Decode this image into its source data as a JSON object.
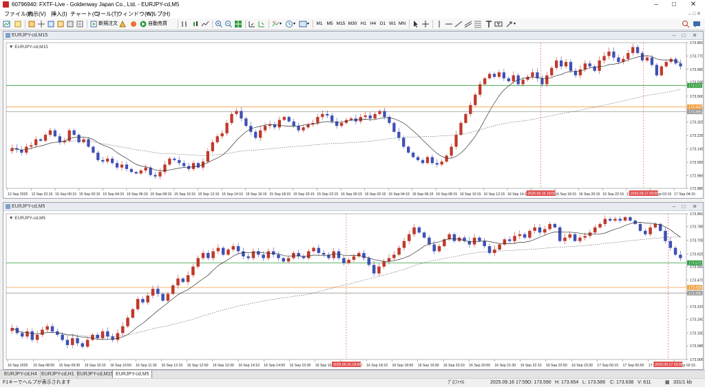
{
  "window": {
    "title": "60796940: FXTF-Live - Goldenway Japan Co., Ltd. - EURJPY-cd,M5"
  },
  "menu": [
    "ファイル(F)",
    "表示(V)",
    "挿入(I)",
    "チャート(C)",
    "ツール(T)",
    "ウィンドウ(W)",
    "ヘルプ(H)"
  ],
  "toolbar": {
    "new_order": "新規注文",
    "auto_trade": "自動売買",
    "timeframes": [
      "M1",
      "M5",
      "M15",
      "M30",
      "H1",
      "H4",
      "D1",
      "W1",
      "MN"
    ]
  },
  "colors": {
    "bull": "#c0392b",
    "bear": "#3f51b5",
    "green_line": "#2e9c3c",
    "orange_line": "#f0a040",
    "vline": "#e05050"
  },
  "charts": [
    {
      "id": "m15",
      "window_title": "EURJPY-cd,M15",
      "label": "EURJPY-cd,M15",
      "chart_data": {
        "type": "candlestick",
        "symbol": "EURJPY-cd",
        "timeframe": "M15",
        "ylim": [
          172.88,
          173.86
        ],
        "yticks": [
          173.86,
          173.77,
          173.68,
          173.595,
          173.5,
          173.415,
          173.325,
          173.235,
          173.145,
          173.055,
          172.965,
          172.88
        ],
        "ytick_labels": [
          "173.860",
          "173.770",
          "173.680",
          "173.595",
          "173.500",
          "173.415",
          "173.325",
          "173.235",
          "173.145",
          "173.055",
          "172.965",
          "172.880"
        ],
        "xtick_labels": [
          "12 Sep 2025",
          "12 Sep 22:15",
          "15 Sep 00:15",
          "15 Sep 02:15",
          "15 Sep 04:15",
          "15 Sep 06:15",
          "15 Sep 08:15",
          "15 Sep 10:15",
          "15 Sep 12:15",
          "15 Sep 14:15",
          "15 Sep 16:15",
          "15 Sep 18:15",
          "15 Sep 20:15",
          "15 Sep 22:15",
          "16 Sep 00:15",
          "16 Sep 02:15",
          "16 Sep 04:15",
          "16 Sep 06:15",
          "16 Sep 08:15",
          "16 Sep 10:15",
          "16 Sep 12:15",
          "16 Sep 14:15",
          "16 Sep 16:15",
          "16 Sep 18:15",
          "16 Sep 20:15",
          "16 Sep 22:15",
          "17 Sep 00:15",
          "17 Sep 02:15",
          "17 Sep 04:15"
        ],
        "hlines": [
          {
            "price": 173.572,
            "label": "173.572",
            "color": "#2e9c3c"
          },
          {
            "price": 173.428,
            "label": "173.428",
            "color": "#f0a040"
          },
          {
            "price": 173.395,
            "label": "173.395",
            "color": "#9a9a9a"
          }
        ],
        "vlines": [
          {
            "label": "2025.09.16 18:00",
            "index": 0.786
          },
          {
            "label": "2025.09.17 03:00",
            "index": 0.937
          }
        ],
        "close": [
          173.15,
          173.14,
          173.12,
          173.16,
          173.17,
          173.21,
          173.2,
          173.24,
          173.27,
          173.23,
          173.19,
          173.2,
          173.27,
          173.24,
          173.19,
          173.21,
          173.16,
          173.12,
          173.07,
          173.06,
          173.08,
          173.05,
          173.02,
          173.04,
          173.01,
          172.99,
          172.98,
          173.0,
          173.02,
          172.97,
          172.96,
          172.99,
          173.04,
          173.08,
          173.07,
          173.05,
          173.03,
          173.01,
          173.05,
          173.02,
          173.06,
          173.13,
          173.19,
          173.23,
          173.25,
          173.32,
          173.38,
          173.4,
          173.35,
          173.3,
          173.26,
          173.22,
          173.27,
          173.3,
          173.31,
          173.29,
          173.34,
          173.36,
          173.33,
          173.3,
          173.27,
          173.29,
          173.31,
          173.32,
          173.36,
          173.38,
          173.37,
          173.33,
          173.3,
          173.32,
          173.34,
          173.35,
          173.33,
          173.36,
          173.37,
          173.35,
          173.38,
          173.4,
          173.36,
          173.32,
          173.26,
          173.22,
          173.16,
          173.12,
          173.09,
          173.07,
          173.05,
          173.09,
          173.05,
          173.04,
          173.06,
          173.1,
          173.16,
          173.24,
          173.32,
          173.38,
          173.44,
          173.51,
          173.58,
          173.62,
          173.65,
          173.63,
          173.66,
          173.62,
          173.6,
          173.64,
          173.58,
          173.61,
          173.63,
          173.66,
          173.62,
          173.58,
          173.64,
          173.69,
          173.74,
          173.7,
          173.73,
          173.67,
          173.64,
          173.68,
          173.72,
          173.7,
          173.67,
          173.74,
          173.77,
          173.8,
          173.76,
          173.73,
          173.75,
          173.79,
          173.83,
          173.79,
          173.74,
          173.76,
          173.71,
          173.64,
          173.7,
          173.73,
          173.75,
          173.72,
          173.7
        ]
      }
    },
    {
      "id": "m5",
      "window_title": "EURJPY-cd,M5",
      "label": "EURJPY-cd,M5",
      "chart_data": {
        "type": "candlestick",
        "symbol": "EURJPY-cd",
        "timeframe": "M5",
        "ylim": [
          173.005,
          173.86
        ],
        "yticks": [
          173.86,
          173.785,
          173.705,
          173.625,
          173.55,
          173.47,
          173.395,
          173.315,
          173.24,
          173.16,
          173.085,
          173.005
        ],
        "ytick_labels": [
          "173.860",
          "173.785",
          "173.705",
          "173.625",
          "173.550",
          "173.470",
          "173.395",
          "173.315",
          "173.240",
          "173.160",
          "173.085",
          "173.005"
        ],
        "xtick_labels": [
          "16 Sep 2025",
          "16 Sep 08:50",
          "16 Sep 09:30",
          "16 Sep 10:10",
          "16 Sep 10:50",
          "16 Sep 11:30",
          "16 Sep 12:10",
          "16 Sep 12:50",
          "16 Sep 13:30",
          "16 Sep 14:10",
          "16 Sep 14:50",
          "16 Sep 15:30",
          "16 Sep 16:10",
          "16 Sep 16:50",
          "16 Sep 18:10",
          "16 Sep 18:50",
          "16 Sep 19:30",
          "16 Sep 20:10",
          "16 Sep 20:50",
          "16 Sep 21:30",
          "16 Sep 22:10",
          "16 Sep 22:50",
          "16 Sep 23:30",
          "17 Sep 00:15",
          "17 Sep 00:55",
          "17 Sep 01:35",
          "17 Sep 02:15"
        ],
        "hlines": [
          {
            "price": 173.572,
            "label": "173.572",
            "color": "#2e9c3c"
          },
          {
            "price": 173.428,
            "label": "173.428",
            "color": "#f0a040"
          },
          {
            "price": 173.395,
            "label": "173.395",
            "color": "#9a9a9a"
          }
        ],
        "vlines": [
          {
            "label": "2025.09.16 18:00",
            "index": 0.5
          },
          {
            "label": "2025.09.17 03:00",
            "index": 0.973
          }
        ],
        "close": [
          173.19,
          173.16,
          173.14,
          173.17,
          173.12,
          173.15,
          173.18,
          173.2,
          173.17,
          173.15,
          173.12,
          173.09,
          173.13,
          173.1,
          173.08,
          173.12,
          173.15,
          173.13,
          173.17,
          173.14,
          173.12,
          173.16,
          173.2,
          173.25,
          173.3,
          173.36,
          173.34,
          173.38,
          173.42,
          173.39,
          173.35,
          173.39,
          173.44,
          173.48,
          173.46,
          173.5,
          173.55,
          173.6,
          173.63,
          173.6,
          173.64,
          173.66,
          173.62,
          173.65,
          173.67,
          173.64,
          173.61,
          173.6,
          173.64,
          173.62,
          173.6,
          173.64,
          173.62,
          173.6,
          173.58,
          173.6,
          173.63,
          173.61,
          173.6,
          173.64,
          173.66,
          173.63,
          173.62,
          173.6,
          173.64,
          173.6,
          173.57,
          173.59,
          173.61,
          173.63,
          173.6,
          173.56,
          173.51,
          173.55,
          173.58,
          173.6,
          173.62,
          173.66,
          173.7,
          173.74,
          173.78,
          173.75,
          173.72,
          173.68,
          173.64,
          173.67,
          173.71,
          173.74,
          173.7,
          173.72,
          173.7,
          173.68,
          173.72,
          173.7,
          173.67,
          173.63,
          173.65,
          173.68,
          173.71,
          173.7,
          173.73,
          173.74,
          173.72,
          173.76,
          173.78,
          173.75,
          173.77,
          173.8,
          173.78,
          173.7,
          173.72,
          173.74,
          173.7,
          173.72,
          173.73,
          173.75,
          173.78,
          173.8,
          173.83,
          173.82,
          173.83,
          173.82,
          173.84,
          173.82,
          173.8,
          173.76,
          173.74,
          173.78,
          173.8,
          173.76,
          173.7,
          173.66,
          173.62,
          173.6
        ]
      }
    }
  ],
  "tabs": [
    "EURJPY-cd,H4",
    "EURJPY-cd,H1",
    "EURJPY-cd,M15",
    "EURJPY-cd,M5"
  ],
  "active_tab": 3,
  "status": {
    "help_text": "F1キーでヘルプが表示されます",
    "profile": "ﾌﾟﾛﾌｧｲﾙ",
    "datetime": "2025.09.16 17:55",
    "o": "O: 173.590",
    "h": "H: 173.654",
    "l": "L: 173.586",
    "c": "C: 173.638",
    "v": "V: 611",
    "traffic": "331/1 kb"
  }
}
